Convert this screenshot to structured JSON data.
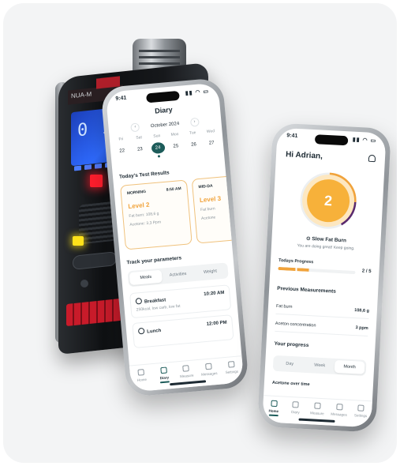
{
  "device": {
    "screen_readout": "0 1_",
    "label": "NUA-M"
  },
  "phone_left": {
    "status_time": "9:41",
    "title": "Diary",
    "month": "October 2024",
    "week": [
      {
        "day": "Fri",
        "num": "22"
      },
      {
        "day": "Sat",
        "num": "23"
      },
      {
        "day": "Sun",
        "num": "24"
      },
      {
        "day": "Mon",
        "num": "25"
      },
      {
        "day": "Tue",
        "num": "26"
      },
      {
        "day": "Wed",
        "num": "27"
      }
    ],
    "selected_day_index": 2,
    "tests_title": "Today's Test Results",
    "tests": [
      {
        "period": "MORNING",
        "time": "8:50 AM",
        "level": "Level 2",
        "fat_burn": "Fat burn: 108,6 g",
        "acetone": "Acetone: 3,3 Ppm"
      },
      {
        "period": "MID-DA",
        "time": "",
        "level": "Level 3",
        "fat_burn": "Fat burn",
        "acetone": "Acetone"
      }
    ],
    "params_title": "Track your parameters",
    "params_tabs": [
      "Meals",
      "Activities",
      "Weight"
    ],
    "meals": [
      {
        "name": "Breakfast",
        "time": "10:20 AM",
        "detail": "250kcal, low carb, low fat"
      },
      {
        "name": "Lunch",
        "time": "12:00 PM",
        "detail": ""
      }
    ],
    "tabs": [
      "Home",
      "Diary",
      "Measure",
      "Messages",
      "Settings"
    ]
  },
  "phone_right": {
    "status_time": "9:41",
    "greeting": "Hi Adrian,",
    "level": "2",
    "state": "Slow Fat Burn",
    "state_sub": "You are doing great! Keep going.",
    "progress_title": "Todays Progress",
    "progress_value": 0.4,
    "progress_count": "2 / 5",
    "prev_title": "Previous Measurements",
    "measurements": [
      {
        "label": "Fat burn",
        "value": "108,6 g"
      },
      {
        "label": "Aceton concentration",
        "value": "3 ppm"
      }
    ],
    "your_progress_title": "Your progress",
    "range_tabs": [
      "Day",
      "Week",
      "Month"
    ],
    "acetone_title": "Acetone over time",
    "tabs": [
      "Home",
      "Diary",
      "Measure",
      "Messages",
      "Settings"
    ]
  },
  "colors": {
    "accent": "#1d5c5a",
    "orange": "#f1a33b",
    "led_red": "#ff1e2d",
    "led_yellow": "#ffe21a"
  }
}
